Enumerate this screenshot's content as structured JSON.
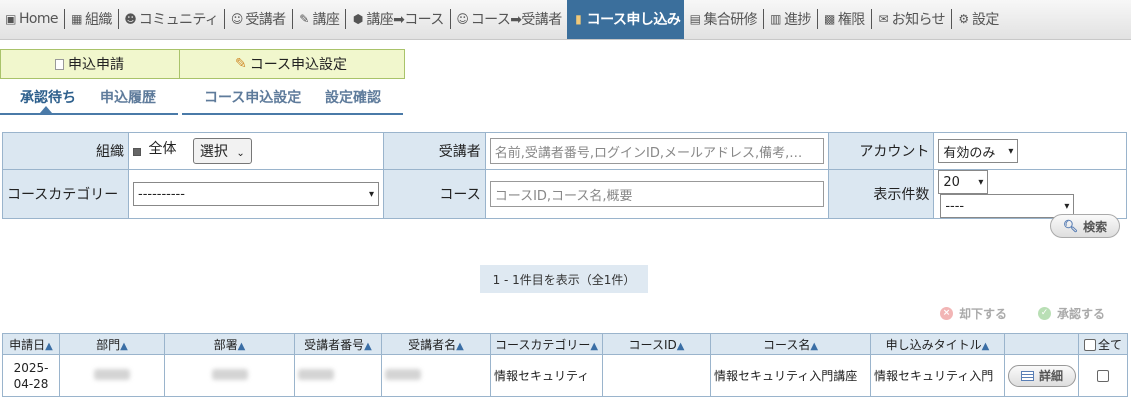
{
  "nav": {
    "items": [
      {
        "label": "Home",
        "icon": "home-icon"
      },
      {
        "label": "組織",
        "icon": "org-icon"
      },
      {
        "label": "コミュニティ",
        "icon": "community-icon"
      },
      {
        "label": "受講者",
        "icon": "user-icon"
      },
      {
        "label": "講座",
        "icon": "pencil-icon"
      },
      {
        "label": "講座➡コース",
        "icon": "box-icon"
      },
      {
        "label": "コース➡受講者",
        "icon": "course-user-icon"
      },
      {
        "label": "コース申し込み",
        "icon": "apply-icon"
      },
      {
        "label": "集合研修",
        "icon": "calendar-icon"
      },
      {
        "label": "進捗",
        "icon": "progress-icon"
      },
      {
        "label": "権限",
        "icon": "lock-icon"
      },
      {
        "label": "お知らせ",
        "icon": "mail-icon"
      },
      {
        "label": "設定",
        "icon": "gear-icon"
      }
    ],
    "active_index": 7
  },
  "tabs": {
    "apply": "申込申請",
    "settings": "コース申込設定"
  },
  "subtabs": {
    "pending": "承認待ち",
    "history": "申込履歴",
    "course_settings": "コース申込設定",
    "confirm": "設定確認"
  },
  "filters": {
    "org_label": "組織",
    "org_value": "全体",
    "org_select_btn": "選択",
    "learner_label": "受講者",
    "learner_placeholder": "名前,受講者番号,ログインID,メールアドレス,備考,…",
    "account_label": "アカウント",
    "account_value": "有効のみ",
    "category_label": "コースカテゴリー",
    "category_value": "----------",
    "course_label": "コース",
    "course_placeholder": "コースID,コース名,概要",
    "count_label": "表示件数",
    "count_value": "20",
    "sort_value": "----"
  },
  "search_label": "検索",
  "page_info": "1 - 1件目を表示（全1件）",
  "actions": {
    "reject": "却下する",
    "approve": "承認する"
  },
  "table": {
    "headers": [
      "申請日▲",
      "部門▲",
      "部署▲",
      "受講者番号▲",
      "受講者名▲",
      "コースカテゴリー▲",
      "コースID▲",
      "コース名▲",
      "申し込みタイトル▲",
      "",
      "全て"
    ],
    "rows": [
      {
        "date": "2025-04-28",
        "category": "情報セキュリティ",
        "course_id": "",
        "course_name": "情報セキュリティ入門講座",
        "apply_title": "情報セキュリティ入門",
        "detail_label": "詳細"
      }
    ]
  }
}
